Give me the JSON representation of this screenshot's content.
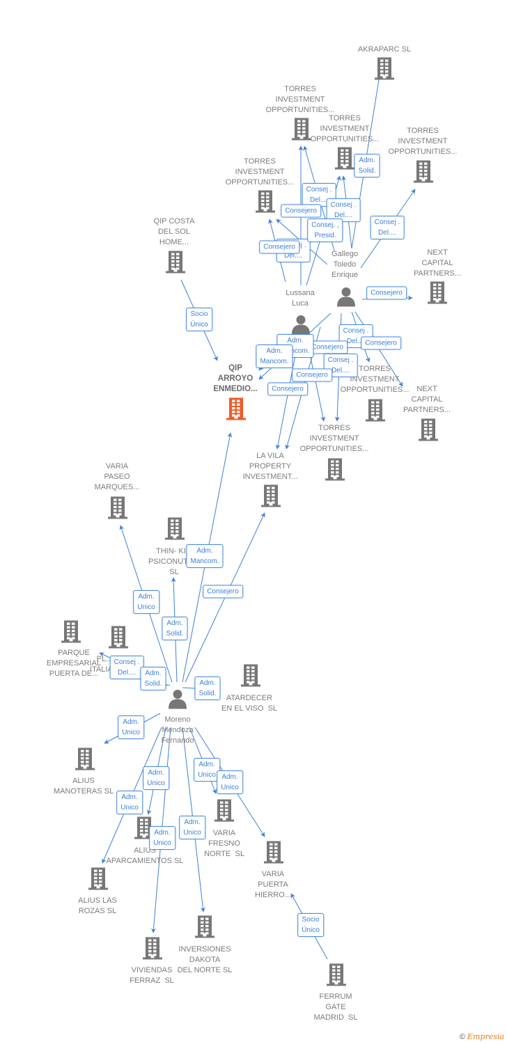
{
  "colors": {
    "edge": "#3d7fd8",
    "building": "#777777",
    "main_building": "#f05a28",
    "person": "#777777"
  },
  "nodes": [
    {
      "type": "company",
      "label": "AKRAPARC SL"
    },
    {
      "type": "company",
      "label": "TORRES\nINVESTMENT\nOPPORTUNITIES..."
    },
    {
      "type": "company",
      "label": "TORRES\nINVESTMENT\nOPPORTUNITIES..."
    },
    {
      "type": "company",
      "label": "TORRES\nINVESTMENT\nOPPORTUNITIES..."
    },
    {
      "type": "company",
      "label": "TORRES\nINVESTMENT\nOPPORTUNITIES..."
    },
    {
      "type": "company",
      "label": "QIP COSTA\nDEL SOL\nHOME..."
    },
    {
      "type": "company",
      "label": "NEXT\nCAPITAL\nPARTNERS..."
    },
    {
      "type": "company",
      "label": "QIP\nARROYO\nENMEDIO...",
      "main": true
    },
    {
      "type": "company",
      "label": "TORRES\nINVESTMENT\nOPPORTUNITIES..."
    },
    {
      "type": "company",
      "label": "NEXT\nCAPITAL\nPARTNERS..."
    },
    {
      "type": "company",
      "label": "TORRES\nINVESTMENT\nOPPORTUNITIES..."
    },
    {
      "type": "company",
      "label": "LA VILA\nPROPERTY\nINVESTMENT..."
    },
    {
      "type": "company",
      "label": "VARIA\nPASEO\nMARQUES..."
    },
    {
      "type": "company",
      "label": "THIN- KI...\nPSICONUTR...\nSL"
    },
    {
      "type": "company",
      "label": "PARQUE\nEMPRESARIAL\nPUERTA DE..."
    },
    {
      "type": "company",
      "label": "PL...\nITALIA..."
    },
    {
      "type": "company",
      "label": "ATARDECER\nEN EL VISO  SL"
    },
    {
      "type": "company",
      "label": "ALIUS\nMANOTERAS SL"
    },
    {
      "type": "company",
      "label": "ALIUS\nAPARCAMIENTOS SL"
    },
    {
      "type": "company",
      "label": "VARIA\nFRESNO\nNORTE  SL"
    },
    {
      "type": "company",
      "label": "VARIA\nPUERTA\nHIERRO..."
    },
    {
      "type": "company",
      "label": "ALIUS LAS\nROZAS SL"
    },
    {
      "type": "company",
      "label": "INVERSIONES\nDAKOTA\nDEL NORTE SL"
    },
    {
      "type": "company",
      "label": "VIVIENDAS\nFERRAZ  SL"
    },
    {
      "type": "company",
      "label": "FERRUM\nGATE\nMADRID  SL"
    },
    {
      "type": "person",
      "label": "Gallego\nToledo\nEnrique"
    },
    {
      "type": "person",
      "label": "Lussana\nLuca"
    },
    {
      "type": "person",
      "label": "Moreno\nMendoza\nFernando"
    }
  ],
  "edges": [
    {
      "from": 25,
      "to": 0,
      "label": "Adm.\nSolid."
    },
    {
      "from": 25,
      "to": 3,
      "label": "Consej .\nDel...."
    },
    {
      "from": 25,
      "to": 6,
      "label": "Consejero"
    },
    {
      "from": 25,
      "to": 1,
      "label": "Consej .\nDel...."
    },
    {
      "from": 26,
      "to": 1,
      "label": "Consej .\nDel...."
    },
    {
      "from": 25,
      "to": 4,
      "label": "Consejero"
    },
    {
      "from": 25,
      "to": 2,
      "label": "Consej .\nDel...."
    },
    {
      "from": 26,
      "to": 2,
      "label": "Consej. ,\nPresid."
    },
    {
      "from": 26,
      "to": 4,
      "label": "Consejero"
    },
    {
      "from": 5,
      "to": 7,
      "label": "Socio\nÚnico"
    },
    {
      "from": 25,
      "to": 8,
      "label": "Consej .\nDel...."
    },
    {
      "from": 25,
      "to": 9,
      "label": "Consejero"
    },
    {
      "from": 26,
      "to": 10,
      "label": "Consejero"
    },
    {
      "from": 25,
      "to": 10,
      "label": "Consej .\nDel...."
    },
    {
      "from": 26,
      "to": 7,
      "label": "Adm.\nMancom."
    },
    {
      "from": 25,
      "to": 7,
      "label": "Adm.\nMancom."
    },
    {
      "from": 25,
      "to": 11,
      "label": "Consejero"
    },
    {
      "from": 26,
      "to": 11,
      "label": "Consejero"
    },
    {
      "from": 27,
      "to": 7,
      "label": "Adm.\nMancom."
    },
    {
      "from": 27,
      "to": 11,
      "label": "Consejero"
    },
    {
      "from": 27,
      "to": 12,
      "label": "Adm.\nUnico"
    },
    {
      "from": 27,
      "to": 13,
      "label": "Adm.\nSolid."
    },
    {
      "from": 27,
      "to": 15,
      "label": "Consej .\nDel...."
    },
    {
      "from": 27,
      "to": 14,
      "label": "Adm.\nSolid."
    },
    {
      "from": 27,
      "to": 16,
      "label": "Adm.\nSolid."
    },
    {
      "from": 27,
      "to": 17,
      "label": "Adm.\nUnico"
    },
    {
      "from": 27,
      "to": 18,
      "label": "Adm.\nUnico"
    },
    {
      "from": 27,
      "to": 21,
      "label": "Adm.\nUnico"
    },
    {
      "from": 27,
      "to": 23,
      "label": "Adm.\nUnico"
    },
    {
      "from": 27,
      "to": 22,
      "label": "Adm.\nUnico"
    },
    {
      "from": 27,
      "to": 19,
      "label": "Adm.\nUnico"
    },
    {
      "from": 27,
      "to": 20,
      "label": "Adm.\nUnico"
    },
    {
      "from": 24,
      "to": 20,
      "label": "Socio\nÚnico"
    }
  ],
  "footer": {
    "copyright": "©",
    "brand": "Empresia"
  }
}
